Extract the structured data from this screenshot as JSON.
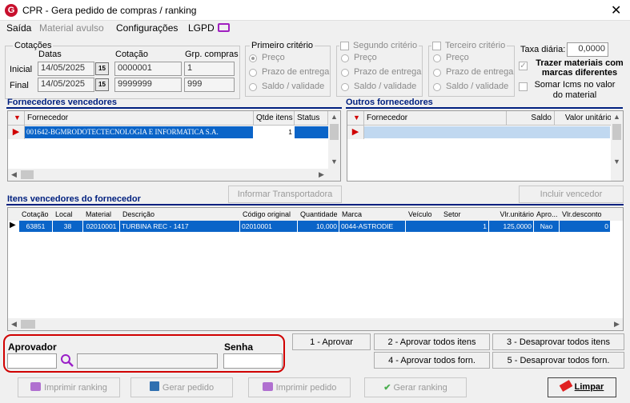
{
  "window": {
    "title": "CPR - Gera pedido de compras / ranking",
    "logo": "G"
  },
  "menu": [
    "Saída",
    "Material avulso",
    "Configurações",
    "LGPD"
  ],
  "cotacoes": {
    "label": "Cotações",
    "col_datas": "Datas",
    "col_cotacao": "Cotação",
    "col_grp": "Grp. compras",
    "row_inicial": "Inicial",
    "row_final": "Final",
    "data_inicial": "14/05/2025",
    "data_final": "14/05/2025",
    "cotacao_inicial": "0000001",
    "cotacao_final": "9999999",
    "grp_inicial": "1",
    "grp_final": "999",
    "cal_label": "15"
  },
  "criterio1": {
    "label": "Primeiro critério",
    "opt1": "Preço",
    "opt2": "Prazo de entrega",
    "opt3": "Saldo / validade"
  },
  "criterio2": {
    "label": "Segundo critério",
    "opt1": "Preço",
    "opt2": "Prazo de entrega",
    "opt3": "Saldo / validade"
  },
  "criterio3": {
    "label": "Terceiro critério",
    "opt1": "Preço",
    "opt2": "Prazo de entrega",
    "opt3": "Saldo / validade"
  },
  "taxa": {
    "label": "Taxa diária:",
    "value": "0,0000"
  },
  "options": {
    "trazer_line1": "Trazer materiais com",
    "trazer_line2": "marcas diferentes",
    "somar_line1": "Somar Icms no valor",
    "somar_line2": "do material"
  },
  "fornecedores_vencedores": {
    "title": "Fornecedores vencedores",
    "headers": [
      "Fornecedor",
      "Qtde itens",
      "Status"
    ],
    "row": {
      "fornecedor": "001642-BGMRODOTECTECNOLOGIA E INFORMATICA S.A.",
      "qtde": "1",
      "status": ""
    }
  },
  "outros_fornecedores": {
    "title": "Outros fornecedores",
    "headers": [
      "Fornecedor",
      "Saldo",
      "Valor unitário"
    ]
  },
  "buttons_mid": {
    "informar": "Informar Transportadora",
    "incluir": "Incluir vencedor"
  },
  "itens": {
    "title": "Itens vencedores do fornecedor",
    "headers": [
      "Cotação",
      "Local",
      "Material",
      "Descrição",
      "Código original",
      "Quantidade",
      "Marca",
      "Veículo",
      "Setor",
      "Vlr.unitário",
      "Apro...",
      "Vlr.desconto"
    ],
    "row": [
      "63851",
      "38",
      "02010001",
      "TURBINA REC - 1417",
      "02010001",
      "10,000",
      "0044-ASTRODIE",
      "",
      "1",
      "125,0000",
      "Nao",
      "0"
    ]
  },
  "aprovador": {
    "label": "Aprovador",
    "senha_label": "Senha"
  },
  "actions": {
    "aprovar": "1 - Aprovar",
    "aprovar_todos_itens": "2 - Aprovar todos itens",
    "desaprovar_todos_itens": "3 - Desaprovar todos itens",
    "aprovar_todos_forn": "4 - Aprovar todos forn.",
    "desaprovar_todos_forn": "5 - Desaprovar todos forn."
  },
  "bottom": {
    "imprimir_ranking": "Imprimir ranking",
    "gerar_pedido": "Gerar pedido",
    "imprimir_pedido": "Imprimir pedido",
    "gerar_ranking": "Gerar ranking",
    "limpar": "Limpar"
  },
  "colors": {
    "accent": "#00207f",
    "selection": "#0a64c8",
    "highlight": "#d00000"
  }
}
